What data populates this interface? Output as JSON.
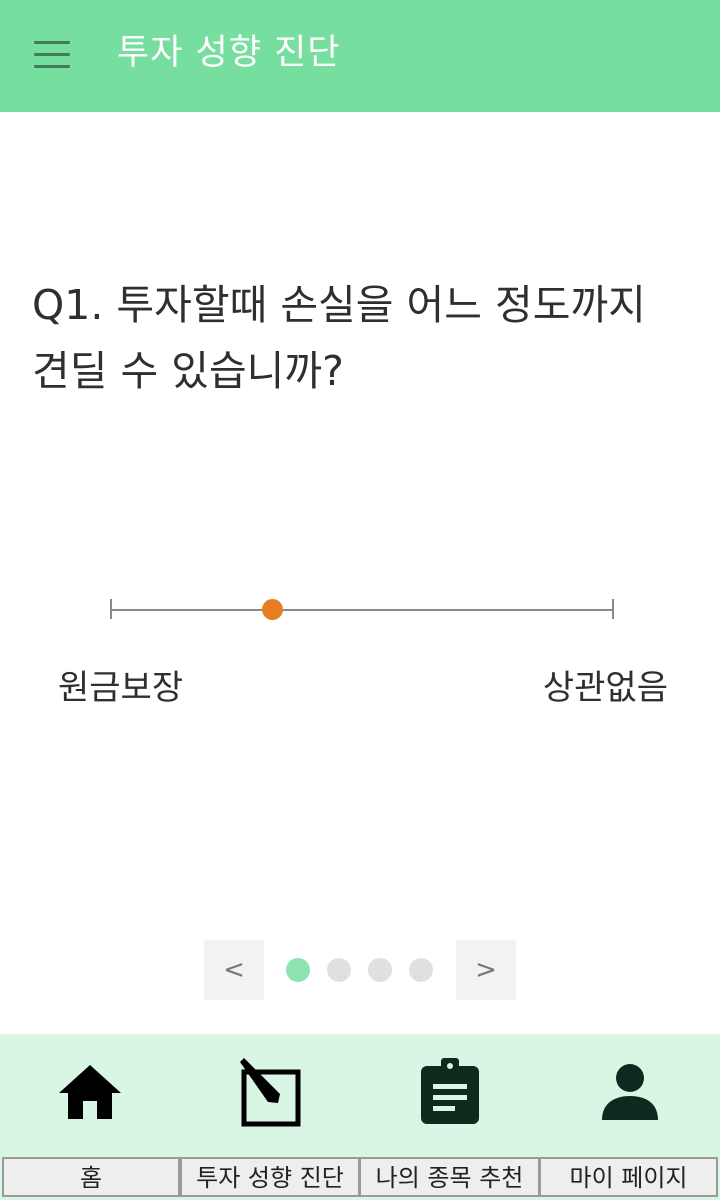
{
  "colors": {
    "primary": "#76df9f",
    "accent": "#e67e22",
    "nav_background": "#d9f5e4",
    "nav_active": "#89e4ac",
    "dot_active": "#8fe3b1",
    "dot_inactive": "#e0e0e0"
  },
  "header": {
    "menu_icon": "hamburger-menu-icon",
    "title": "투자 성향 진단"
  },
  "question": {
    "number": "Q1.",
    "text": "Q1. 투자할때 손실을 어느 정도까지 견딜 수 있습니까?"
  },
  "slider": {
    "value_fraction": 0.32,
    "min_label": "원금보장",
    "max_label": "상관없음"
  },
  "pager": {
    "prev_label": "<",
    "next_label": ">",
    "total_pages": 4,
    "current_page": 1
  },
  "bottom_nav": {
    "active_index": 1,
    "items": [
      {
        "label": "홈",
        "icon": "home-icon"
      },
      {
        "label": "투자 성향 진단",
        "icon": "edit-icon"
      },
      {
        "label": "나의 종목 추천",
        "icon": "clipboard-icon"
      },
      {
        "label": "마이 페이지",
        "icon": "person-icon"
      }
    ]
  }
}
